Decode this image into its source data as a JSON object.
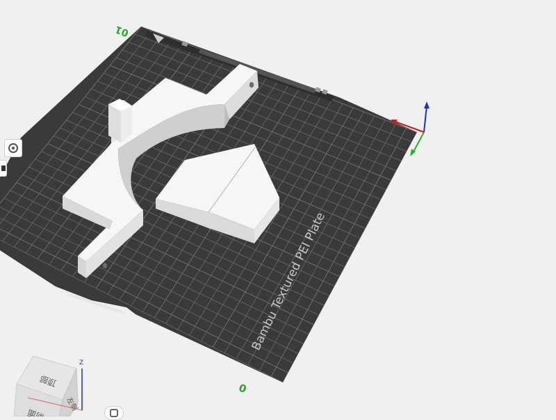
{
  "viewport": {
    "background": "#f0f0f0",
    "plate": {
      "name": "Bambu Textured PEI Plate",
      "plate_color": "#3a3a3a",
      "grid_color": "#6e6e6e",
      "corner_label_top": "01",
      "corner_label_bottom": "0"
    },
    "model_color": "#f4f4f4",
    "axes": {
      "x_color": "#d11a1a",
      "y_color": "#1fb31f",
      "z_color": "#1a2fc8"
    },
    "view_cube": {
      "top_label": "顶部",
      "front_label": "前面",
      "right_label": "左侧",
      "axis_label": "Z"
    },
    "toolbar": {
      "icons": [
        "fit-view-icon",
        "assemble-view-icon",
        "rotate-view-icon"
      ]
    }
  }
}
